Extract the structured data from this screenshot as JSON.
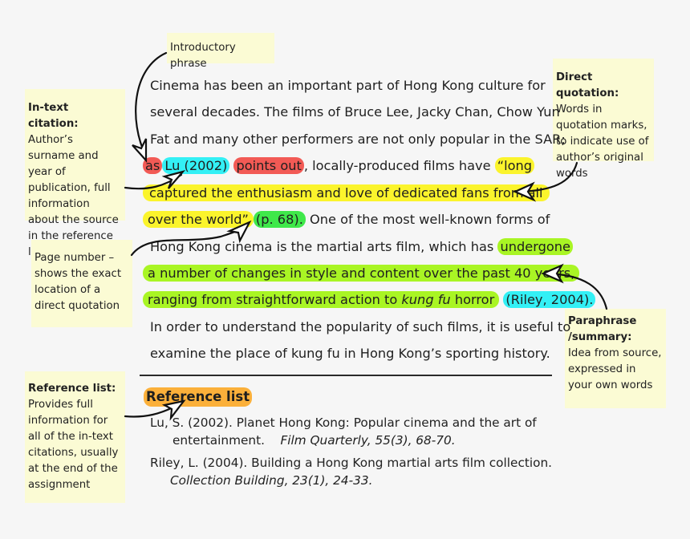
{
  "notes": {
    "introductory": {
      "text": "Introductory phrase"
    },
    "in_text_citation": {
      "title": "In-text citation:",
      "body": "Author’s surname and year of publication, full information about the source in the reference list"
    },
    "direct_quotation": {
      "title": "Direct quotation:",
      "body": "Words in quotation marks, to indicate use of author’s original words"
    },
    "page_number": {
      "body": "Page number –shows the exact location of a direct quotation"
    },
    "paraphrase": {
      "title": "Paraphrase /summary:",
      "body": "Idea from source, expressed in your own words"
    },
    "reference_list": {
      "title": "Reference list:",
      "body": "Provides full information for all of the in-text citations, usually at the end of the assignment"
    }
  },
  "paragraph": {
    "l1": "Cinema has been an important part of Hong Kong culture for",
    "l2": "several decades. The films of Bruce Lee, Jacky Chan, Chow Yun",
    "l3": "Fat and many other performers are not only popular in the SAR;",
    "l4": {
      "as": "as",
      "cite": "Lu (2002)",
      "points": "points out",
      "rest": ", locally-produced films have ",
      "quote": "“long"
    },
    "l5": "captured the enthusiasm and love of dedicated fans from all",
    "l6": {
      "quote": "over the world”",
      "page": "(p. 68).",
      "rest": " One of the most well-known forms of"
    },
    "l7": {
      "pre": "Hong Kong cinema is the martial arts film, which has ",
      "para": "undergone"
    },
    "l8": "a number of changes in style and content over the past 40 years,",
    "l9": {
      "pre": "ranging from straightforward action to ",
      "italic": "kung fu",
      "post": " horror",
      "cite": "(Riley, 2004)."
    },
    "l10": "In order to understand the popularity of such films, it is useful to",
    "l11": "examine the place of kung fu in Hong Kong’s sporting history."
  },
  "references": {
    "heading": "Reference list",
    "entries": [
      {
        "line1": "Lu, S. (2002). Planet Hong Kong: Popular cinema and the art of",
        "line2_plain": "entertainment.",
        "line2_italic": "Film Quarterly, 55(3), 68-70."
      },
      {
        "line1": "Riley, L. (2004). Building a Hong Kong martial arts film collection.",
        "line2_italic": "Collection Building, 23(1), 24-33."
      }
    ]
  },
  "colors": {
    "note_bg": "#fbfbd4",
    "red": "#f25a55",
    "cyan": "#33f0f5",
    "yellow": "#fbf42c",
    "green": "#3fe84a",
    "lime": "#a9f524",
    "orange": "#fbb03a"
  }
}
